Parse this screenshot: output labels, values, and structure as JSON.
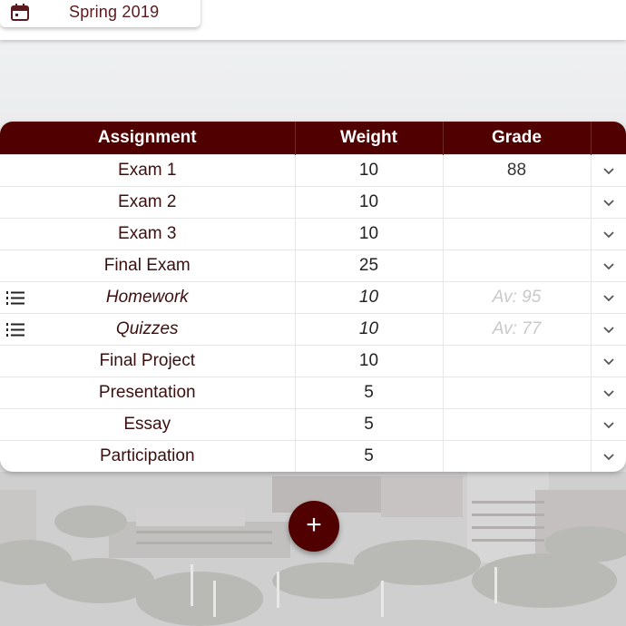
{
  "semester": {
    "icon": "calendar-icon",
    "label": "Spring 2019"
  },
  "table": {
    "headers": [
      "Assignment",
      "Weight",
      "Grade"
    ],
    "rows": [
      {
        "name": "Exam 1",
        "weight": "10",
        "grade": "88",
        "category": false
      },
      {
        "name": "Exam 2",
        "weight": "10",
        "grade": "",
        "category": false
      },
      {
        "name": "Exam 3",
        "weight": "10",
        "grade": "",
        "category": false
      },
      {
        "name": "Final Exam",
        "weight": "25",
        "grade": "",
        "category": false
      },
      {
        "name": "Homework",
        "weight": "10",
        "grade": "Av: 95",
        "category": true
      },
      {
        "name": "Quizzes",
        "weight": "10",
        "grade": "Av: 77",
        "category": true
      },
      {
        "name": "Final Project",
        "weight": "10",
        "grade": "",
        "category": false
      },
      {
        "name": "Presentation",
        "weight": "5",
        "grade": "",
        "category": false
      },
      {
        "name": "Essay",
        "weight": "5",
        "grade": "",
        "category": false
      },
      {
        "name": "Participation",
        "weight": "5",
        "grade": "",
        "category": false
      }
    ],
    "row_action_icon": "chevron-down-icon",
    "category_icon": "numbered-list-icon"
  },
  "fab": {
    "label": "+",
    "icon": "add-icon"
  },
  "colors": {
    "primary": "#500000",
    "text_maroon": "#5b1a1d",
    "placeholder_gray": "#c9c9c9"
  }
}
